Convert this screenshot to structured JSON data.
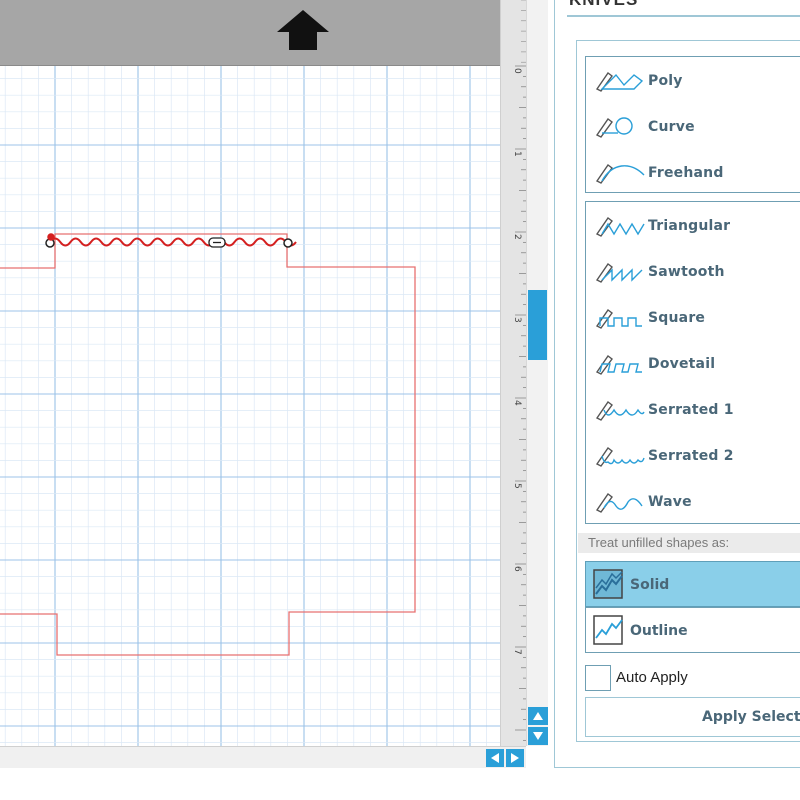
{
  "panel": {
    "title": "KNIVES",
    "accent_color": "#2a9fd8",
    "label_color": "#4a6778",
    "basic_knives": [
      {
        "label": "Poly",
        "icon": "poly-knife-icon"
      },
      {
        "label": "Curve",
        "icon": "curve-knife-icon"
      },
      {
        "label": "Freehand",
        "icon": "freehand-knife-icon"
      }
    ],
    "pattern_knives": [
      {
        "label": "Triangular",
        "icon": "triangular-knife-icon"
      },
      {
        "label": "Sawtooth",
        "icon": "sawtooth-knife-icon"
      },
      {
        "label": "Square",
        "icon": "square-knife-icon"
      },
      {
        "label": "Dovetail",
        "icon": "dovetail-knife-icon"
      },
      {
        "label": "Serrated 1",
        "icon": "serrated-1-knife-icon"
      },
      {
        "label": "Serrated 2",
        "icon": "serrated-2-knife-icon"
      },
      {
        "label": "Wave",
        "icon": "wave-knife-icon"
      }
    ],
    "treat_label": "Treat unfilled shapes as:",
    "shape_modes": [
      {
        "label": "Solid",
        "icon": "solid-shape-icon",
        "selected": true
      },
      {
        "label": "Outline",
        "icon": "outline-shape-icon",
        "selected": false
      }
    ],
    "auto_apply": {
      "label": "Auto Apply",
      "checked": false
    },
    "apply_button": "Apply Selected"
  },
  "ruler": {
    "labels": [
      "0",
      "1",
      "2",
      "3",
      "4",
      "5",
      "6",
      "7"
    ]
  },
  "canvas": {
    "grid_color": "#b8d4ee",
    "shape_color": "#e87070",
    "cut_line_color": "#d42020"
  }
}
